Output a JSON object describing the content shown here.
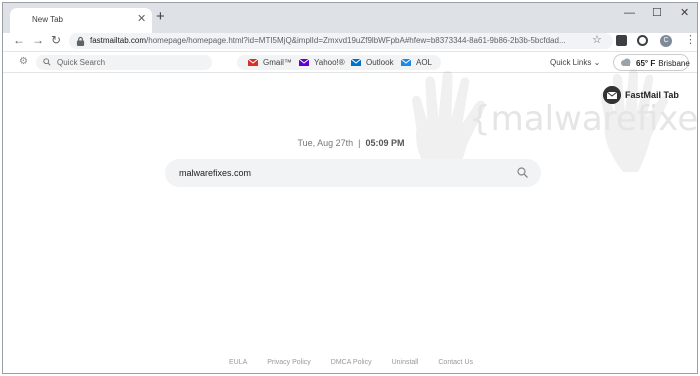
{
  "browser": {
    "tab_title": "New Tab",
    "url_host": "fastmailtab.com",
    "url_path": "/homepage/homepage.html?id=MTI5MjQ&implId=Zmxvd19uZf9lbWFpbA#hfew=b8373344-8a61-9b86-2b3b-5bcfdad...",
    "avatar_letter": "C"
  },
  "pagebar": {
    "quick_search_placeholder": "Quick Search",
    "mail_links": [
      {
        "label": "Gmail™",
        "color": "#d93025"
      },
      {
        "label": "Yahoo!®",
        "color": "#6001d2"
      },
      {
        "label": "Outlook",
        "color": "#0072c6"
      },
      {
        "label": "AOL",
        "color": "#1e88e5"
      }
    ],
    "quick_links_label": "Quick Links",
    "weather_temp": "65° F",
    "weather_city": "Brisbane"
  },
  "main": {
    "brand_name": "FastMail Tab",
    "date": "Tue, Aug 27th",
    "separator": "|",
    "time": "05:09 PM",
    "search_value": "malwarefixes.com",
    "watermark": "{malwarefixes}"
  },
  "footer": {
    "links": [
      "EULA",
      "Privacy Policy",
      "DMCA Policy",
      "Uninstall",
      "Contact Us"
    ]
  }
}
